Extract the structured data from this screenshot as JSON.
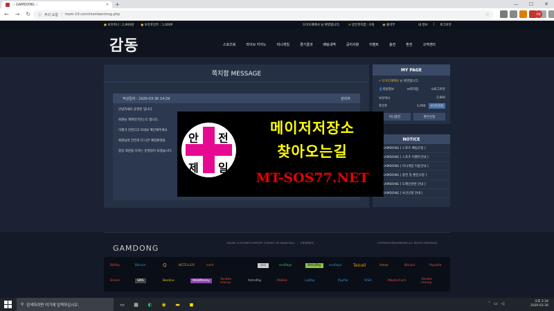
{
  "browser": {
    "tab_title": ":: GAMDONG ::",
    "url_security": "주의 요함",
    "url": "mom-10.com/member/msg.php",
    "ext_labels": [
      "",
      "",
      "",
      "",
      "",
      ""
    ],
    "profile_text": "ON"
  },
  "topbar": {
    "money_label": "보유머니 : 2,900원",
    "point_label": "보유포인트 : 1,000P",
    "welcome": "도어도재메샤 님 환영합니다.",
    "messages": "받은쪽지함 : 0개",
    "attendance": "출석부",
    "myinfo": "내 정보",
    "logout": "로그아웃"
  },
  "header": {
    "logo": "감동",
    "menu": [
      "스포츠북",
      "라이브 카지노",
      "미니게임",
      "경기결과",
      "베팅내역",
      "공지사항",
      "이벤트",
      "충전",
      "환전",
      "고객센터"
    ]
  },
  "message": {
    "title": "쪽지함 MESSAGE",
    "date": "작성일자 : 2020-03-30 14:29",
    "author": "관리자",
    "lines": [
      "안녕하세요 운영진 입니다.",
      "회원님 계좌한가인는도 합니다.",
      "이제가 안된다고 뜨네요 확인해주세요.",
      "회원님의 안전과 더 나은 베팅환경을",
      "항상 회원을 다하는 운영팀이 되겠습니다."
    ]
  },
  "mypage": {
    "title": "MY PAGE",
    "user_name": "도어도재메샤",
    "user_suffix": " 님 환영합니다.",
    "links": [
      "회원정보",
      "쪽지함",
      "로그아웃"
    ],
    "money_label": "보유머니",
    "money_value": "2,900",
    "point_label": "포인트",
    "point_value": "1,000",
    "point_button": "포인트전환",
    "charge_button": "머니충전",
    "withdraw_button": "환전신청"
  },
  "notice": {
    "title": "NOTICE",
    "items": [
      "GAMDONG [ 스포츠 베팅규정 ]",
      "GAMDONG [ 스포츠 이벤트안내 ]",
      "GAMDONG [ 미니게임 이용안내 ]",
      "GAMDONG [ 충전 및 환전규정 ]",
      "GAMDONG [ 도메인관련 안내 ]",
      "GAMDONG [ 보안규정 안내 ]"
    ]
  },
  "footer": {
    "logo": "GAMDONG",
    "support": [
      "ONLINE CUSTOMER SUPPORT CONTACT BY KAKAOTALK",
      ":",
      "고객센터문의"
    ],
    "copyright": "COPYRIGHT@GAMDONG ALL RIGHTS RESERVED",
    "payments_row1": [
      "BitPay",
      "Bitcoin",
      "Q",
      "NETELLER",
      "kash",
      "eco",
      "ecoPayz",
      "AstroPay",
      "ecoPayz",
      "Telcell",
      "Amex",
      "Bitcoin",
      "Paysafe"
    ],
    "payments_row2": [
      "Diners",
      "SMS",
      "Beeline",
      "WebMoney",
      "Yandex money",
      "AstroPay",
      "Mobile",
      "LiqPay",
      "PayPal",
      "VISA",
      "MasterCard",
      "Yandex money"
    ]
  },
  "ad": {
    "seal_chars": [
      "안",
      "전",
      "제",
      "일"
    ],
    "line1": "메이저저장소",
    "line2": "찾아오는길",
    "line3": "MT-SOS77.NET"
  },
  "taskbar": {
    "search_placeholder": "검색하려면 여기에 입력하십시오.",
    "time": "오후 2:34",
    "date": "2020-03-30"
  }
}
